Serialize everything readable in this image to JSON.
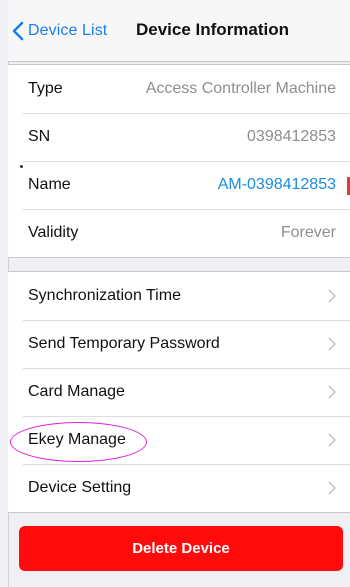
{
  "nav": {
    "back_label": "Device List",
    "title": "Device Information"
  },
  "info": [
    {
      "label": "Type",
      "value": "Access Controller Machine"
    },
    {
      "label": "SN",
      "value": "0398412853"
    },
    {
      "label": "Name",
      "value": "AM-0398412853"
    },
    {
      "label": "Validity",
      "value": "Forever"
    }
  ],
  "menu": [
    {
      "label": "Synchronization Time"
    },
    {
      "label": "Send Temporary Password"
    },
    {
      "label": "Card Manage"
    },
    {
      "label": "Ekey Manage"
    },
    {
      "label": "Device Setting"
    }
  ],
  "delete_label": "Delete Device",
  "colors": {
    "accent": "#1a7fe8",
    "link_value": "#1a8de0",
    "danger": "#ff0b0b",
    "highlight_circle": "#e020d8"
  },
  "icons": {
    "back": "chevron-left-icon",
    "row_disclosure": "chevron-right-icon"
  }
}
